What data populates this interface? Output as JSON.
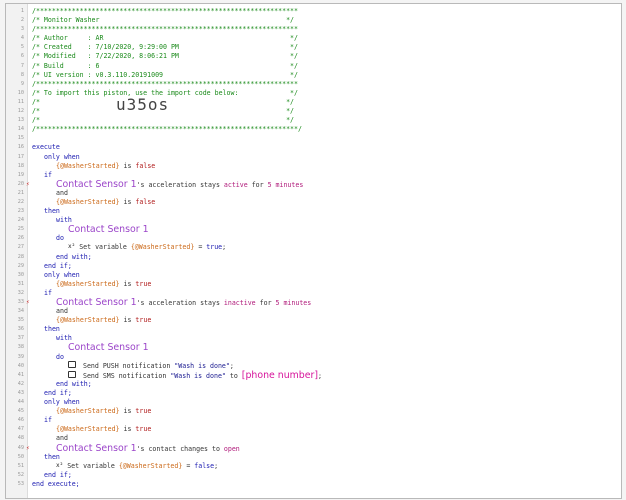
{
  "editor": {
    "lines": [
      {
        "n": "1",
        "segs": [
          {
            "t": "/******************************************************************",
            "c": "comment"
          }
        ]
      },
      {
        "n": "2",
        "segs": [
          {
            "t": "/* Monitor Washer                                               */",
            "c": "comment"
          }
        ]
      },
      {
        "n": "3",
        "segs": [
          {
            "t": "/******************************************************************",
            "c": "comment"
          }
        ]
      },
      {
        "n": "4",
        "segs": [
          {
            "t": "/* Author     : AR                                               */",
            "c": "comment"
          }
        ]
      },
      {
        "n": "5",
        "segs": [
          {
            "t": "/* Created    : 7/10/2020, 9:29:00 PM                            */",
            "c": "comment"
          }
        ]
      },
      {
        "n": "6",
        "segs": [
          {
            "t": "/* Modified   : 7/22/2020, 8:06:21 PM                            */",
            "c": "comment"
          }
        ]
      },
      {
        "n": "7",
        "segs": [
          {
            "t": "/* Build      : 6                                                */",
            "c": "comment"
          }
        ]
      },
      {
        "n": "8",
        "segs": [
          {
            "t": "/* UI version : v0.3.110.20191009                                */",
            "c": "comment"
          }
        ]
      },
      {
        "n": "9",
        "segs": [
          {
            "t": "/******************************************************************",
            "c": "comment"
          }
        ]
      },
      {
        "n": "10",
        "segs": [
          {
            "t": "/* To import this piston, use the import code below:             */",
            "c": "comment"
          }
        ]
      },
      {
        "n": "11",
        "segs": [
          {
            "t": "/*                                                              */",
            "c": "comment"
          }
        ]
      },
      {
        "n": "12",
        "segs": [
          {
            "t": "/*                                                              */",
            "c": "comment"
          }
        ]
      },
      {
        "n": "13",
        "segs": [
          {
            "t": "/*                                                              */",
            "c": "comment"
          }
        ]
      },
      {
        "n": "14",
        "segs": [
          {
            "t": "/******************************************************************/",
            "c": "comment"
          }
        ]
      },
      {
        "n": "15",
        "segs": []
      },
      {
        "n": "16",
        "segs": [
          {
            "t": "execute",
            "c": "kw"
          }
        ]
      },
      {
        "n": "17",
        "indent": 1,
        "segs": [
          {
            "t": "only when",
            "c": "kw"
          }
        ]
      },
      {
        "n": "18",
        "indent": 2,
        "segs": [
          {
            "t": "{@WasherStarted}",
            "c": "var"
          },
          {
            "t": " is ",
            "c": "plain"
          },
          {
            "t": "false",
            "c": "false"
          }
        ]
      },
      {
        "n": "19",
        "indent": 1,
        "segs": [
          {
            "t": "if",
            "c": "kw"
          }
        ]
      },
      {
        "n": "20",
        "indent": 2,
        "mark": true,
        "segs": [
          {
            "t": "Contact Sensor 1",
            "c": "dev",
            "big": true
          },
          {
            "t": "'s acceleration stays ",
            "c": "plain"
          },
          {
            "t": "active",
            "c": "val"
          },
          {
            "t": " for ",
            "c": "plain"
          },
          {
            "t": "5 minutes",
            "c": "val"
          }
        ]
      },
      {
        "n": "21",
        "indent": 2,
        "segs": [
          {
            "t": "and",
            "c": "plain"
          }
        ]
      },
      {
        "n": "22",
        "indent": 2,
        "segs": [
          {
            "t": "{@WasherStarted}",
            "c": "var"
          },
          {
            "t": " is ",
            "c": "plain"
          },
          {
            "t": "false",
            "c": "false"
          }
        ]
      },
      {
        "n": "23",
        "indent": 1,
        "segs": [
          {
            "t": "then",
            "c": "kw"
          }
        ]
      },
      {
        "n": "24",
        "indent": 2,
        "segs": [
          {
            "t": "with",
            "c": "kw"
          }
        ]
      },
      {
        "n": "25",
        "indent": 3,
        "segs": [
          {
            "t": "Contact Sensor 1",
            "c": "dev",
            "big": true
          }
        ]
      },
      {
        "n": "26",
        "indent": 2,
        "segs": [
          {
            "t": "do",
            "c": "kw"
          }
        ]
      },
      {
        "n": "27",
        "indent": 3,
        "segs": [
          {
            "t": "x²",
            "c": "x"
          },
          {
            "t": " Set variable ",
            "c": "plain"
          },
          {
            "t": "{@WasherStarted}",
            "c": "var"
          },
          {
            "t": " = ",
            "c": "plain"
          },
          {
            "t": "true",
            "c": "kw"
          },
          {
            "t": ";",
            "c": "plain"
          }
        ]
      },
      {
        "n": "28",
        "indent": 2,
        "segs": [
          {
            "t": "end with;",
            "c": "kw"
          }
        ]
      },
      {
        "n": "29",
        "indent": 1,
        "segs": [
          {
            "t": "end if;",
            "c": "kw"
          }
        ]
      },
      {
        "n": "30",
        "indent": 1,
        "segs": [
          {
            "t": "only when",
            "c": "kw"
          }
        ]
      },
      {
        "n": "31",
        "indent": 2,
        "segs": [
          {
            "t": "{@WasherStarted}",
            "c": "var"
          },
          {
            "t": " is ",
            "c": "plain"
          },
          {
            "t": "true",
            "c": "false"
          }
        ]
      },
      {
        "n": "32",
        "indent": 1,
        "segs": [
          {
            "t": "if",
            "c": "kw"
          }
        ]
      },
      {
        "n": "33",
        "indent": 2,
        "mark": true,
        "segs": [
          {
            "t": "Contact Sensor 1",
            "c": "dev",
            "big": true
          },
          {
            "t": "'s acceleration stays ",
            "c": "plain"
          },
          {
            "t": "inactive",
            "c": "val"
          },
          {
            "t": " for ",
            "c": "plain"
          },
          {
            "t": "5 minutes",
            "c": "val"
          }
        ]
      },
      {
        "n": "34",
        "indent": 2,
        "segs": [
          {
            "t": "and",
            "c": "plain"
          }
        ]
      },
      {
        "n": "35",
        "indent": 2,
        "segs": [
          {
            "t": "{@WasherStarted}",
            "c": "var"
          },
          {
            "t": " is ",
            "c": "plain"
          },
          {
            "t": "true",
            "c": "false"
          }
        ]
      },
      {
        "n": "36",
        "indent": 1,
        "segs": [
          {
            "t": "then",
            "c": "kw"
          }
        ]
      },
      {
        "n": "37",
        "indent": 2,
        "segs": [
          {
            "t": "with",
            "c": "kw"
          }
        ]
      },
      {
        "n": "38",
        "indent": 3,
        "segs": [
          {
            "t": "Contact Sensor 1",
            "c": "dev",
            "big": true
          }
        ]
      },
      {
        "n": "39",
        "indent": 2,
        "segs": [
          {
            "t": "do",
            "c": "kw"
          }
        ]
      },
      {
        "n": "40",
        "indent": 3,
        "segs": [
          {
            "t": "msg",
            "c": "icon"
          },
          {
            "t": " Send PUSH notification ",
            "c": "plain"
          },
          {
            "t": "\"Wash is done\"",
            "c": "str"
          },
          {
            "t": ";",
            "c": "plain"
          }
        ]
      },
      {
        "n": "41",
        "indent": 3,
        "segs": [
          {
            "t": "msg",
            "c": "icon"
          },
          {
            "t": " Send SMS notification ",
            "c": "plain"
          },
          {
            "t": "\"Wash is done\"",
            "c": "str"
          },
          {
            "t": " to ",
            "c": "plain"
          },
          {
            "t": "[phone number]",
            "c": "bigval",
            "big": true
          },
          {
            "t": ";",
            "c": "plain"
          }
        ]
      },
      {
        "n": "42",
        "indent": 2,
        "segs": [
          {
            "t": "end with;",
            "c": "kw"
          }
        ]
      },
      {
        "n": "43",
        "indent": 1,
        "segs": [
          {
            "t": "end if;",
            "c": "kw"
          }
        ]
      },
      {
        "n": "44",
        "indent": 1,
        "segs": [
          {
            "t": "only when",
            "c": "kw"
          }
        ]
      },
      {
        "n": "45",
        "indent": 2,
        "segs": [
          {
            "t": "{@WasherStarted}",
            "c": "var"
          },
          {
            "t": " is ",
            "c": "plain"
          },
          {
            "t": "true",
            "c": "false"
          }
        ]
      },
      {
        "n": "46",
        "indent": 1,
        "segs": [
          {
            "t": "if",
            "c": "kw"
          }
        ]
      },
      {
        "n": "47",
        "indent": 2,
        "segs": [
          {
            "t": "{@WasherStarted}",
            "c": "var"
          },
          {
            "t": " is ",
            "c": "plain"
          },
          {
            "t": "true",
            "c": "false"
          }
        ]
      },
      {
        "n": "48",
        "indent": 2,
        "segs": [
          {
            "t": "and",
            "c": "plain"
          }
        ]
      },
      {
        "n": "49",
        "indent": 2,
        "mark": true,
        "segs": [
          {
            "t": "Contact Sensor 1",
            "c": "dev",
            "big": true
          },
          {
            "t": "'s contact changes to ",
            "c": "plain"
          },
          {
            "t": "open",
            "c": "val"
          }
        ]
      },
      {
        "n": "50",
        "indent": 1,
        "segs": [
          {
            "t": "then",
            "c": "kw"
          }
        ]
      },
      {
        "n": "51",
        "indent": 2,
        "segs": [
          {
            "t": "x²",
            "c": "x"
          },
          {
            "t": " Set variable ",
            "c": "plain"
          },
          {
            "t": "{@WasherStarted}",
            "c": "var"
          },
          {
            "t": " = ",
            "c": "plain"
          },
          {
            "t": "false",
            "c": "kw"
          },
          {
            "t": ";",
            "c": "plain"
          }
        ]
      },
      {
        "n": "52",
        "indent": 1,
        "segs": [
          {
            "t": "end if;",
            "c": "kw"
          }
        ]
      },
      {
        "n": "53",
        "segs": [
          {
            "t": "end execute;",
            "c": "kw"
          }
        ]
      }
    ],
    "import_code": "u35os",
    "gutter_mark": "⚡"
  }
}
